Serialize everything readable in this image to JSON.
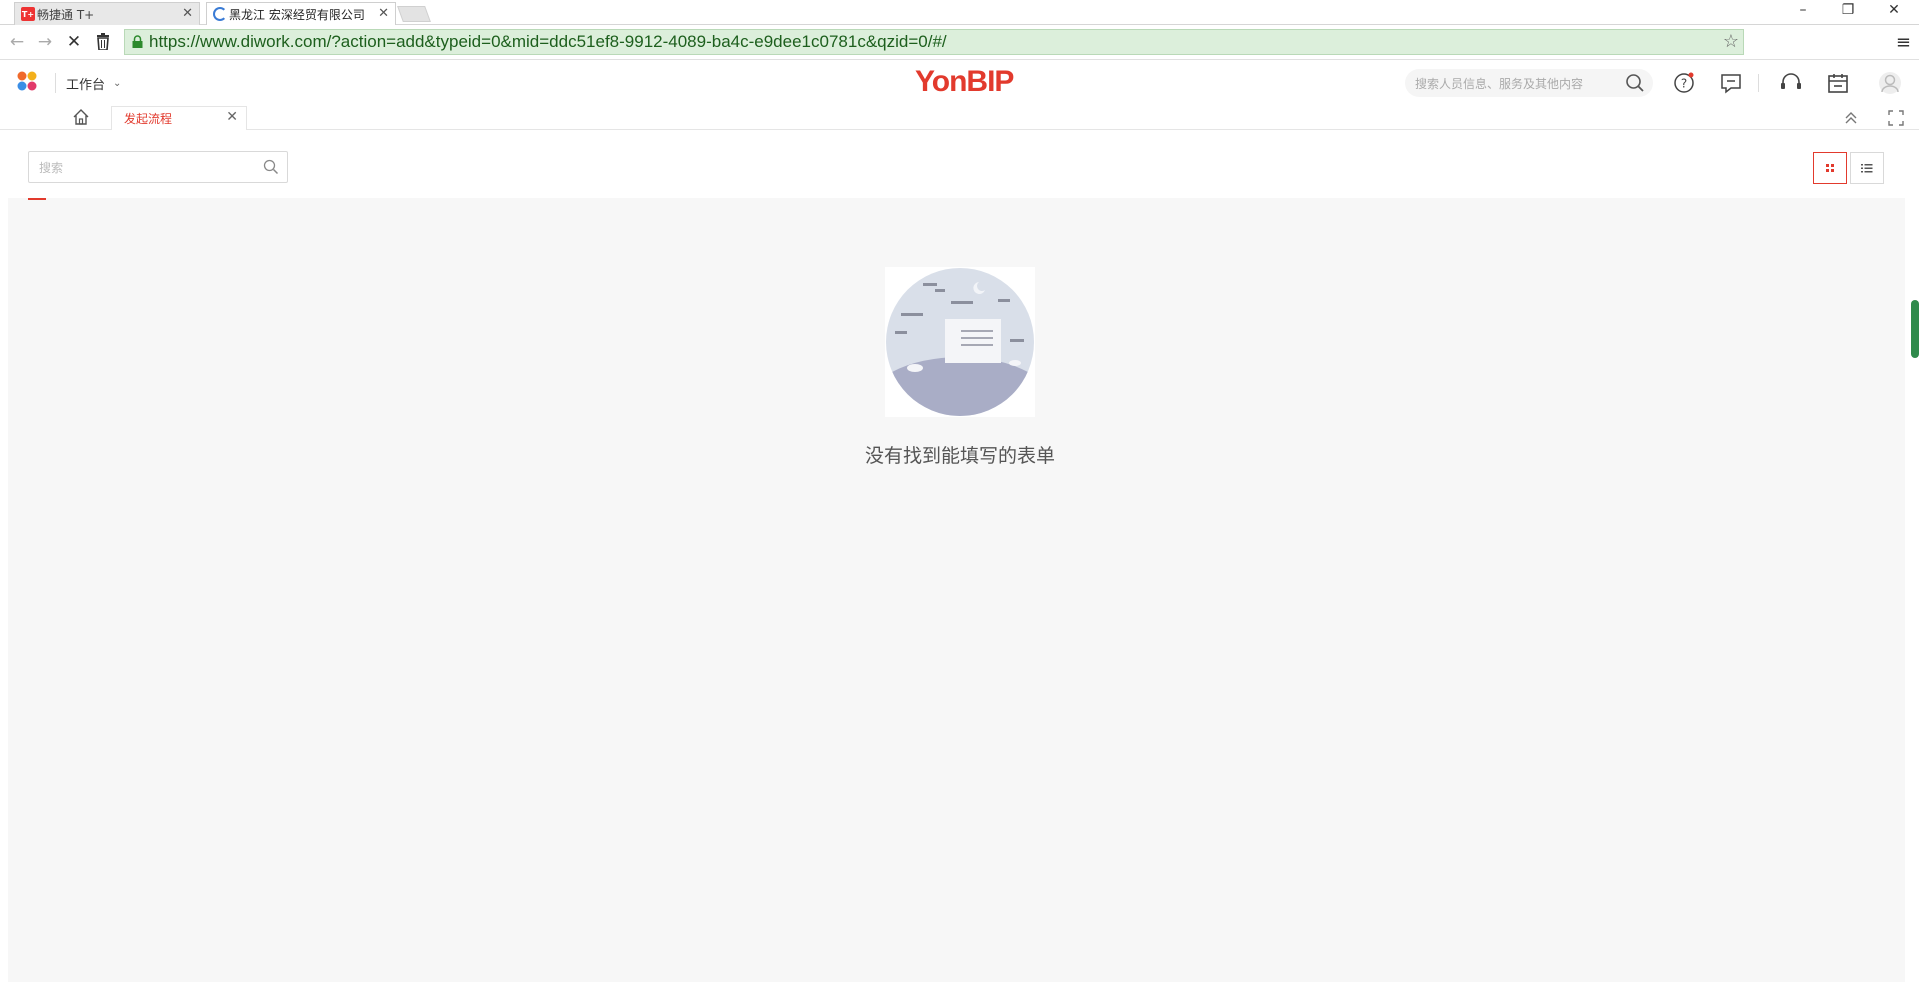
{
  "browser": {
    "tabs": [
      {
        "title": "畅捷通 T+",
        "favicon": "tplus-icon",
        "active": false
      },
      {
        "title": "黑龙江 宏深经贸有限公司",
        "favicon": "loading-spinner-icon",
        "active": true
      }
    ],
    "url": "https://www.diwork.com/?action=add&typeid=0&mid=ddc51ef8-9912-4089-ba4c-e9dee1c0781c&qzid=0/#/",
    "url_bar_color": "#dcefdb"
  },
  "app": {
    "workbench_label": "工作台",
    "brand": "YonBIP",
    "brand_color": "#e23a2d",
    "global_search_placeholder": "搜索人员信息、服务及其他内容"
  },
  "page_tabs": [
    {
      "label": "发起流程",
      "active": true
    }
  ],
  "content": {
    "search_placeholder": "搜索",
    "view_modes": [
      "grid",
      "list"
    ],
    "active_view": "grid",
    "empty_message": "没有找到能填写的表单"
  }
}
